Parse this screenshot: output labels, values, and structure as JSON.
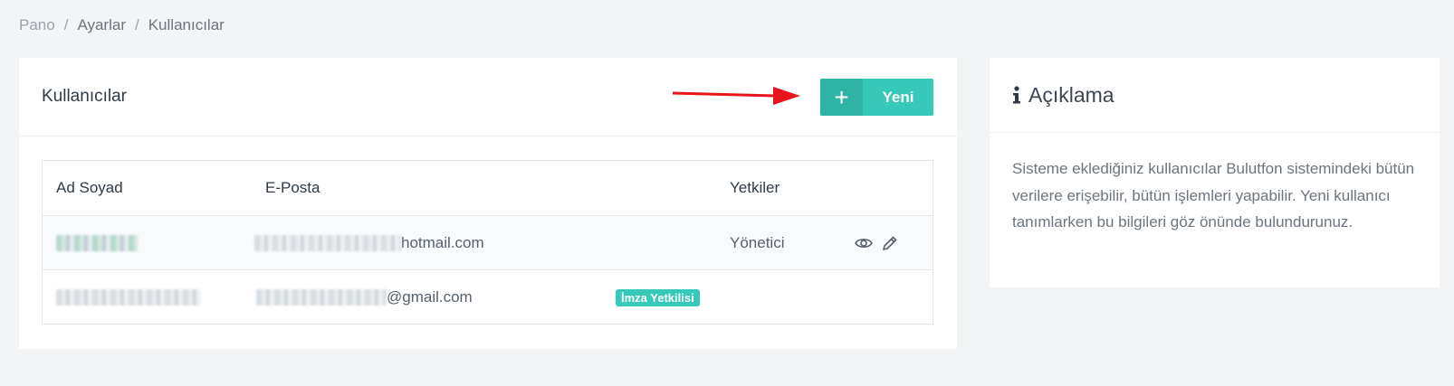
{
  "breadcrumb": {
    "items": [
      "Pano",
      "Ayarlar",
      "Kullanıcılar"
    ],
    "separator": "/"
  },
  "users_card": {
    "title": "Kullanıcılar",
    "new_button": {
      "icon": "plus-icon",
      "label": "Yeni"
    },
    "table": {
      "columns": [
        "Ad Soyad",
        "E-Posta",
        "Yetkiler"
      ],
      "rows": [
        {
          "name": "",
          "email_suffix": "hotmail.com",
          "role": "Yönetici",
          "badge": "",
          "actions": [
            "eye-icon",
            "pencil-icon"
          ]
        },
        {
          "name": "",
          "email_suffix": "@gmail.com",
          "role": "",
          "badge": "İmza Yetkilisi",
          "actions": []
        }
      ]
    }
  },
  "info_card": {
    "icon": "info-icon",
    "title": "Açıklama",
    "body": "Sisteme eklediğiniz kullanıcılar Bulutfon sistemindeki bütün verilere erişebilir, bütün işlemleri yapabilir. Yeni kullanıcı tanımlarken bu bilgileri göz önünde bulundurunuz."
  },
  "colors": {
    "accent": "#36c9b9",
    "accent_dark": "#2fb3a5",
    "annotation_arrow": "#e8141b",
    "background": "#f3f4f6"
  }
}
